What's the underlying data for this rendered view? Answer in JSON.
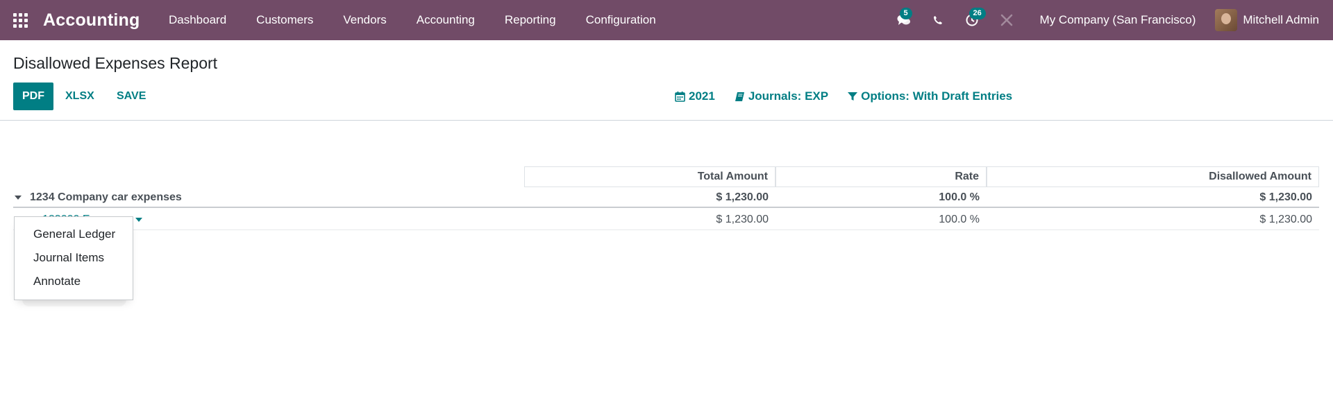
{
  "navbar": {
    "brand": "Accounting",
    "menu": [
      "Dashboard",
      "Customers",
      "Vendors",
      "Accounting",
      "Reporting",
      "Configuration"
    ],
    "messages_badge": "5",
    "activities_badge": "26",
    "company": "My Company (San Francisco)",
    "user": "Mitchell Admin"
  },
  "control_panel": {
    "title": "Disallowed Expenses Report",
    "buttons": {
      "pdf": "PDF",
      "xlsx": "XLSX",
      "save": "SAVE"
    },
    "filters": {
      "date": "2021",
      "journals": "Journals: EXP",
      "options": "Options: With Draft Entries"
    }
  },
  "report": {
    "columns": [
      "Total Amount",
      "Rate",
      "Disallowed Amount"
    ],
    "group": {
      "label": "1234 Company car expenses",
      "total": "$ 1,230.00",
      "rate": "100.0 %",
      "disallowed": "$ 1,230.00"
    },
    "line": {
      "label": "123000 Expenses",
      "total": "$ 1,230.00",
      "rate": "100.0 %",
      "disallowed": "$ 1,230.00"
    }
  },
  "dropdown": {
    "items": [
      "General Ledger",
      "Journal Items",
      "Annotate"
    ]
  },
  "colors": {
    "navbar": "#714b67",
    "accent": "#017e84"
  },
  "icons": {
    "apps": "apps-grid-icon",
    "chat": "chat-icon",
    "phone": "phone-icon",
    "activity": "clock-icon",
    "debug": "tools-icon",
    "calendar": "calendar-icon",
    "book": "book-icon",
    "filter": "filter-icon"
  }
}
